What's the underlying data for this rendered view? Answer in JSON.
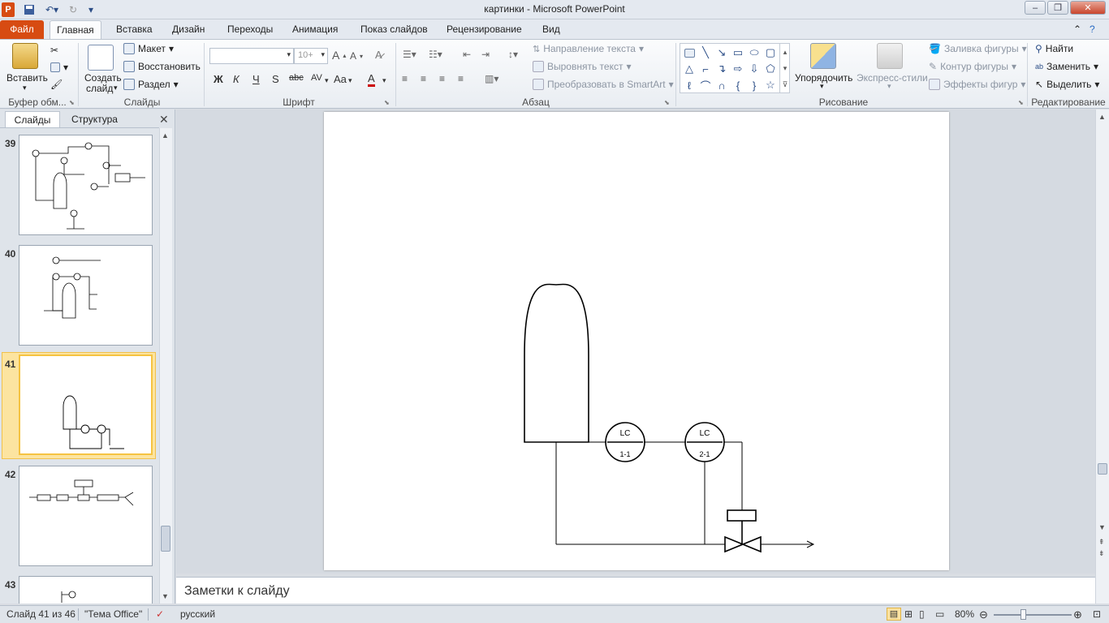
{
  "window": {
    "title": "картинки  -  Microsoft PowerPoint",
    "app_icon": "powerpoint-icon"
  },
  "tabs": {
    "file": "Файл",
    "home": "Главная",
    "insert": "Вставка",
    "design": "Дизайн",
    "transitions": "Переходы",
    "animation": "Анимация",
    "slideshow": "Показ слайдов",
    "review": "Рецензирование",
    "view": "Вид"
  },
  "ribbon": {
    "clipboard": {
      "paste": "Вставить",
      "label": "Буфер обм..."
    },
    "slides": {
      "new_slide_line1": "Создать",
      "new_slide_line2": "слайд",
      "layout": "Макет",
      "reset": "Восстановить",
      "section": "Раздел",
      "label": "Слайды"
    },
    "font": {
      "size": "10+",
      "bold": "Ж",
      "italic": "К",
      "underline": "Ч",
      "shadow": "S",
      "strike": "abc",
      "spacing": "AV",
      "case": "Aa",
      "color": "A",
      "label": "Шрифт"
    },
    "paragraph": {
      "text_direction": "Направление текста",
      "align_text": "Выровнять текст",
      "smartart": "Преобразовать в SmartArt",
      "label": "Абзац"
    },
    "drawing": {
      "arrange": "Упорядочить",
      "quick_styles": "Экспресс-стили",
      "shape_fill": "Заливка фигуры",
      "shape_outline": "Контур фигуры",
      "shape_effects": "Эффекты фигур",
      "label": "Рисование"
    },
    "editing": {
      "find": "Найти",
      "replace": "Заменить",
      "select": "Выделить",
      "label": "Редактирование"
    }
  },
  "left_panel": {
    "tab_slides": "Слайды",
    "tab_outline": "Структура",
    "slides": [
      {
        "num": "39"
      },
      {
        "num": "40"
      },
      {
        "num": "41"
      },
      {
        "num": "42"
      },
      {
        "num": "43"
      }
    ]
  },
  "slide_content": {
    "lc1_top": "LC",
    "lc1_bottom": "1-1",
    "lc2_top": "LC",
    "lc2_bottom": "2-1"
  },
  "notes": {
    "placeholder": "Заметки к слайду"
  },
  "status": {
    "slide_counter": "Слайд 41 из 46",
    "theme": "\"Тема Office\"",
    "language": "русский",
    "zoom": "80%"
  }
}
